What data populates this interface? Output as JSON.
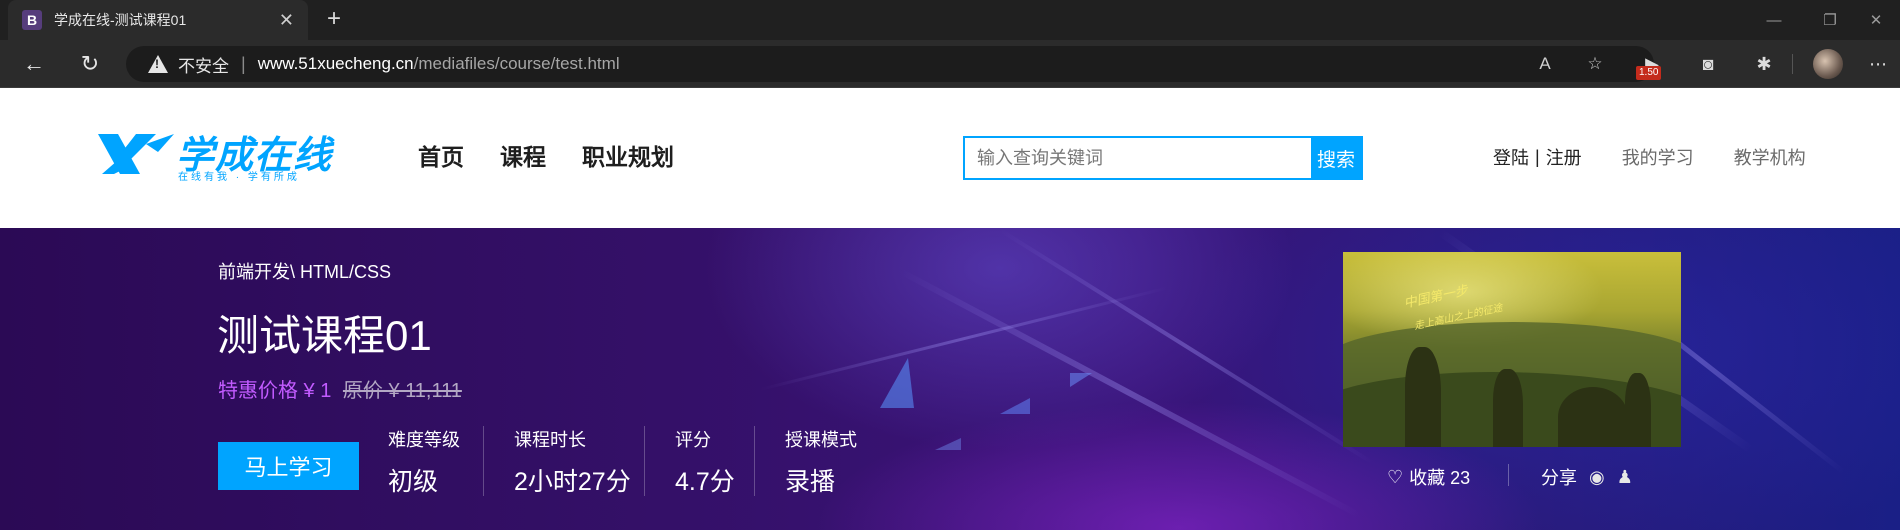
{
  "browser": {
    "tab_title": "学成在线-测试课程01",
    "favicon_letter": "B",
    "security_label": "不安全",
    "url_host": "www.51xuecheng.cn",
    "url_path": "/mediafiles/course/test.html",
    "extension_badge": "1.50"
  },
  "site": {
    "logo_text": "学成在线",
    "logo_slogan": "在线有我 · 学有所成",
    "nav": [
      "首页",
      "课程",
      "职业规划"
    ],
    "search_placeholder": "输入查询关键词",
    "search_button": "搜索",
    "login": "登陆",
    "register": "注册",
    "my_learning": "我的学习",
    "institutions": "教学机构"
  },
  "course": {
    "breadcrumb": "前端开发\\ HTML/CSS",
    "title": "测试课程01",
    "price_now": "特惠价格 ¥ 1",
    "price_old": "原价 ¥ 11,111",
    "study_button": "马上学习",
    "stats": [
      {
        "label": "难度等级",
        "value": "初级"
      },
      {
        "label": "课程时长",
        "value": "2小时27分"
      },
      {
        "label": "评分",
        "value": "4.7分"
      },
      {
        "label": "授课模式",
        "value": "录播"
      }
    ],
    "thumbnail_caption_1": "中国第一步",
    "thumbnail_caption_2": "走上高山之上的征途",
    "favorite_label": "收藏 23",
    "share_label": "分享"
  }
}
